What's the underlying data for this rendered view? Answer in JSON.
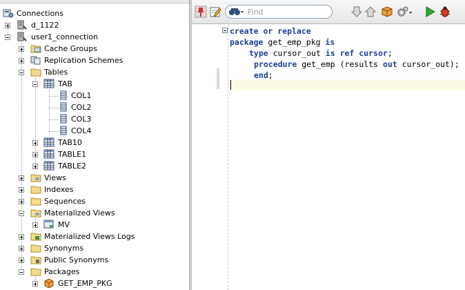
{
  "navigator": {
    "root_label": "Connections",
    "items": [
      {
        "label": "d_1122",
        "icon": "database-connection-icon"
      },
      {
        "label": "user1_connection",
        "icon": "database-connection-icon"
      },
      {
        "label": "Cache Groups",
        "icon": "cache-groups-folder-icon"
      },
      {
        "label": "Replication Schemes",
        "icon": "replication-folder-icon"
      },
      {
        "label": "Tables",
        "icon": "folder-icon"
      },
      {
        "label": "TAB",
        "icon": "table-icon"
      },
      {
        "label": "COL1",
        "icon": "column-icon"
      },
      {
        "label": "COL2",
        "icon": "column-icon"
      },
      {
        "label": "COL3",
        "icon": "column-icon"
      },
      {
        "label": "COL4",
        "icon": "column-icon"
      },
      {
        "label": "TAB10",
        "icon": "table-icon"
      },
      {
        "label": "TABLE1",
        "icon": "table-icon"
      },
      {
        "label": "TABLE2",
        "icon": "table-icon"
      },
      {
        "label": "Views",
        "icon": "folder-icon"
      },
      {
        "label": "Indexes",
        "icon": "folder-icon"
      },
      {
        "label": "Sequences",
        "icon": "folder-icon"
      },
      {
        "label": "Materialized Views",
        "icon": "folder-icon"
      },
      {
        "label": "MV",
        "icon": "materialized-view-icon"
      },
      {
        "label": "Materialized Views Logs",
        "icon": "folder-icon"
      },
      {
        "label": "Synonyms",
        "icon": "folder-icon"
      },
      {
        "label": "Public Synonyms",
        "icon": "folder-icon"
      },
      {
        "label": "Packages",
        "icon": "folder-icon"
      },
      {
        "label": "GET_EMP_PKG",
        "icon": "package-icon"
      }
    ]
  },
  "toolbar": {
    "search_placeholder": "Find",
    "icons": [
      "pin-icon",
      "edit-icon",
      "binoculars-icon",
      "find-next-icon",
      "find-previous-icon",
      "package-icon",
      "gear-icon",
      "run-icon",
      "debug-icon"
    ]
  },
  "editor": {
    "lines": [
      {
        "k1": "create or replace",
        "t1": ""
      },
      {
        "k1": "package",
        "t1": " get_emp_pkg ",
        "k2": "is"
      },
      {
        "k1": "type",
        "t1": " cursor_out ",
        "k2": "is ref cursor",
        "t2": ";"
      },
      {
        "k1": "procedure",
        "t1": " get_emp (results ",
        "k2": "out",
        "t2": " cursor_out);"
      },
      {
        "k1": "end",
        "t1": ";"
      }
    ]
  },
  "colors": {
    "keyword": "#1f3c9e",
    "current_line": "#fbfbe6"
  }
}
